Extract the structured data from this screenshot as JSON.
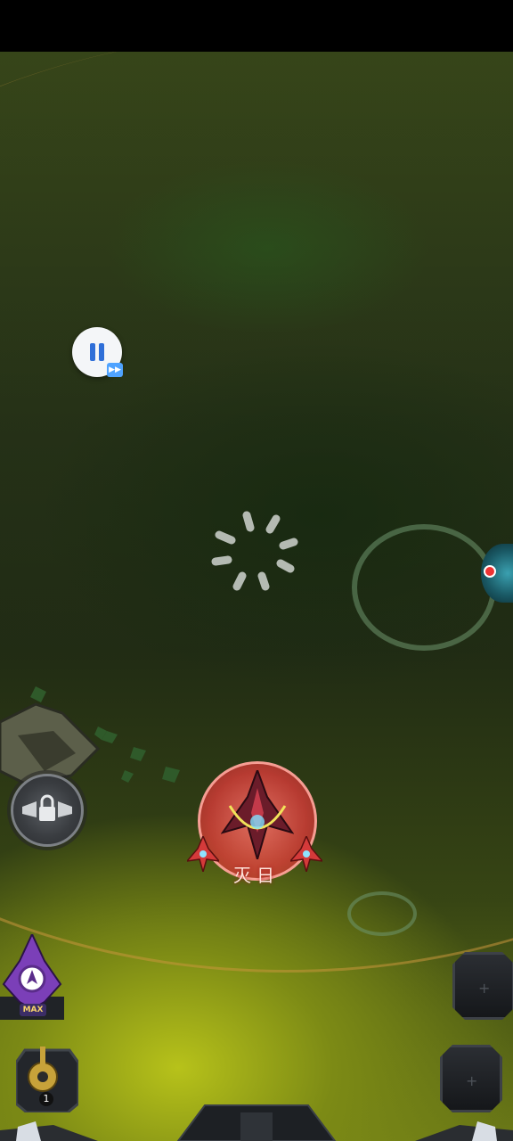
{
  "game": {
    "player_ship_name": "灭日",
    "ship_level_badge": "MAX",
    "support_count": "1",
    "pause_icon": "pause-icon",
    "fast_forward_icon": "fast-forward-icon",
    "lock_icon": "lock-icon",
    "loading_icon": "loading-spinner-icon"
  },
  "colors": {
    "shield": "#e84a44",
    "pause_accent": "#2f6fd8",
    "planet_glow": "#b7c21a"
  }
}
